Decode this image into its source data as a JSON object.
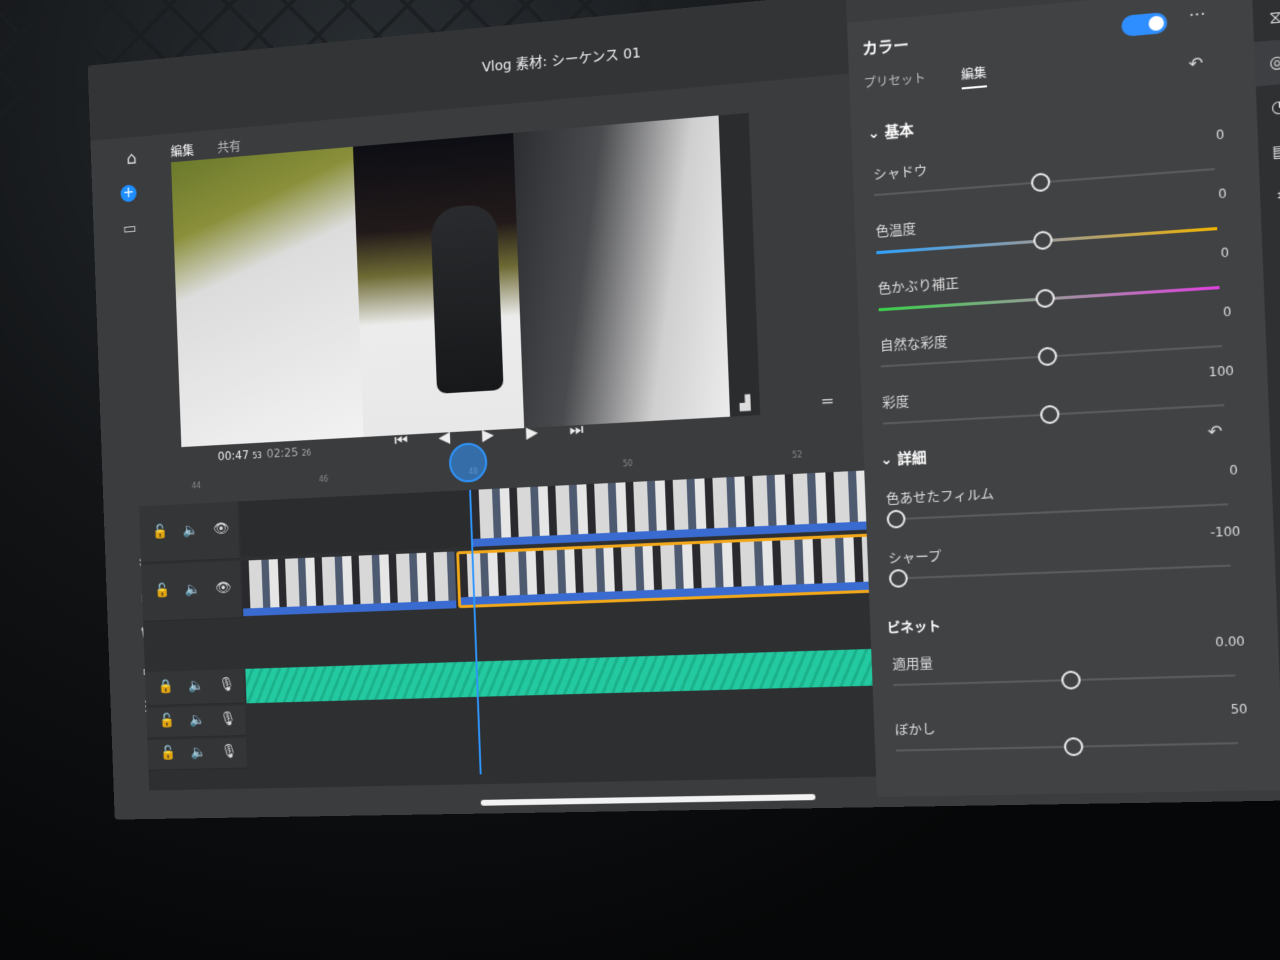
{
  "header": {
    "title": "Vlog 素材: シーケンス 01",
    "tabs": [
      {
        "label": "編集",
        "active": true
      },
      {
        "label": "共有",
        "active": false
      }
    ]
  },
  "player": {
    "current_time": "00:47",
    "current_frames": "53",
    "duration": "02:25",
    "duration_frames": "26",
    "controls": [
      "skip-to-start",
      "step-back",
      "play",
      "step-forward",
      "skip-to-end"
    ]
  },
  "ruler": {
    "ticks": [
      "44",
      "46",
      "48",
      "50",
      "52"
    ]
  },
  "tracks": {
    "video_tracks": 2,
    "audio_tracks": 3
  },
  "color_panel": {
    "title": "カラー",
    "enabled": true,
    "tabs": [
      {
        "label": "プリセット",
        "active": false
      },
      {
        "label": "編集",
        "active": true
      }
    ],
    "basic": {
      "heading": "基本",
      "sliders": [
        {
          "label": "シャドウ",
          "value": "0",
          "position": 0.5
        },
        {
          "label": "色温度",
          "value": "0",
          "position": 0.5
        },
        {
          "label": "色かぶり補正",
          "value": "0",
          "position": 0.5
        },
        {
          "label": "自然な彩度",
          "value": "0",
          "position": 0.5
        },
        {
          "label": "彩度",
          "value": "100",
          "position": 0.5
        }
      ]
    },
    "detail": {
      "heading": "詳細",
      "sliders": [
        {
          "label": "色あせたフィルム",
          "value": "0",
          "position": 0.0
        },
        {
          "label": "シャープ",
          "value": "-100",
          "position": 0.0
        }
      ],
      "vignette": {
        "heading": "ビネット",
        "sliders": [
          {
            "label": "適用量",
            "value": "0.00",
            "position": 0.5
          },
          {
            "label": "ぼかし",
            "value": "50",
            "position": 0.5
          }
        ]
      }
    }
  },
  "accent_color": "#2f8eff",
  "selection_color": "#f3a81a",
  "audio_color": "#23c9a0"
}
